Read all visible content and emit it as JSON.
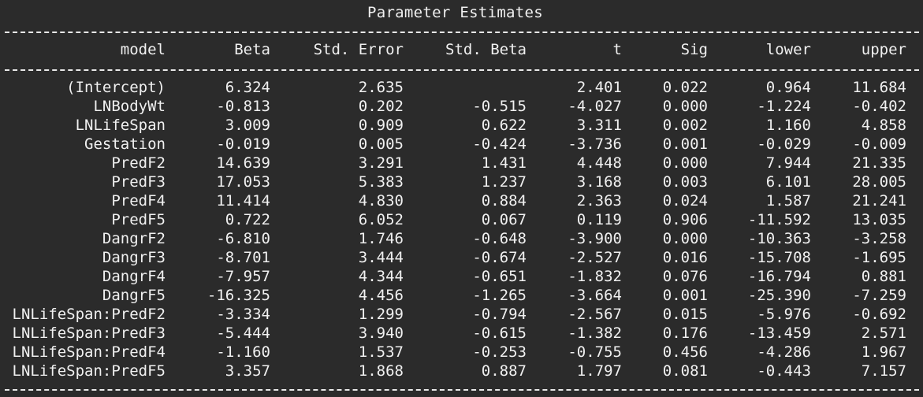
{
  "title": "Parameter Estimates",
  "columns": [
    "model",
    "Beta",
    "Std. Error",
    "Std. Beta",
    "t",
    "Sig",
    "lower",
    "upper"
  ],
  "rows": [
    [
      "(Intercept)",
      "6.324",
      "2.635",
      "",
      "2.401",
      "0.022",
      "0.964",
      "11.684"
    ],
    [
      "LNBodyWt",
      "-0.813",
      "0.202",
      "-0.515",
      "-4.027",
      "0.000",
      "-1.224",
      "-0.402"
    ],
    [
      "LNLifeSpan",
      "3.009",
      "0.909",
      "0.622",
      "3.311",
      "0.002",
      "1.160",
      "4.858"
    ],
    [
      "Gestation",
      "-0.019",
      "0.005",
      "-0.424",
      "-3.736",
      "0.001",
      "-0.029",
      "-0.009"
    ],
    [
      "PredF2",
      "14.639",
      "3.291",
      "1.431",
      "4.448",
      "0.000",
      "7.944",
      "21.335"
    ],
    [
      "PredF3",
      "17.053",
      "5.383",
      "1.237",
      "3.168",
      "0.003",
      "6.101",
      "28.005"
    ],
    [
      "PredF4",
      "11.414",
      "4.830",
      "0.884",
      "2.363",
      "0.024",
      "1.587",
      "21.241"
    ],
    [
      "PredF5",
      "0.722",
      "6.052",
      "0.067",
      "0.119",
      "0.906",
      "-11.592",
      "13.035"
    ],
    [
      "DangrF2",
      "-6.810",
      "1.746",
      "-0.648",
      "-3.900",
      "0.000",
      "-10.363",
      "-3.258"
    ],
    [
      "DangrF3",
      "-8.701",
      "3.444",
      "-0.674",
      "-2.527",
      "0.016",
      "-15.708",
      "-1.695"
    ],
    [
      "DangrF4",
      "-7.957",
      "4.344",
      "-0.651",
      "-1.832",
      "0.076",
      "-16.794",
      "0.881"
    ],
    [
      "DangrF5",
      "-16.325",
      "4.456",
      "-1.265",
      "-3.664",
      "0.001",
      "-25.390",
      "-7.259"
    ],
    [
      "LNLifeSpan:PredF2",
      "-3.334",
      "1.299",
      "-0.794",
      "-2.567",
      "0.015",
      "-5.976",
      "-0.692"
    ],
    [
      "LNLifeSpan:PredF3",
      "-5.444",
      "3.940",
      "-0.615",
      "-1.382",
      "0.176",
      "-13.459",
      "2.571"
    ],
    [
      "LNLifeSpan:PredF4",
      "-1.160",
      "1.537",
      "-0.253",
      "-0.755",
      "0.456",
      "-4.286",
      "1.967"
    ],
    [
      "LNLifeSpan:PredF5",
      "3.357",
      "1.868",
      "0.887",
      "1.797",
      "0.081",
      "-0.443",
      "7.157"
    ]
  ]
}
